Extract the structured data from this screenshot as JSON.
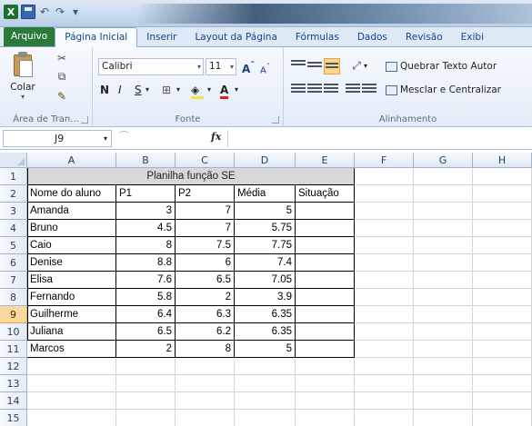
{
  "qat": {
    "app_letter": "X"
  },
  "tabs": [
    "Arquivo",
    "Página Inicial",
    "Inserir",
    "Layout da Página",
    "Fórmulas",
    "Dados",
    "Revisão",
    "Exibi"
  ],
  "ribbon": {
    "clipboard": {
      "paste_label": "Colar",
      "group_label": "Área de Tran..."
    },
    "font": {
      "font_name": "Calibri",
      "font_size": "11",
      "bold": "N",
      "italic": "I",
      "underline": "S",
      "group_label": "Fonte"
    },
    "alignment": {
      "wrap_label": "Quebrar Texto Autor",
      "merge_label": "Mesclar e Centralizar",
      "group_label": "Alinhamento"
    }
  },
  "formula_bar": {
    "name_box": "J9",
    "fx": "fx",
    "value": ""
  },
  "columns": [
    "A",
    "B",
    "C",
    "D",
    "E",
    "F",
    "G",
    "H"
  ],
  "rows": [
    "1",
    "2",
    "3",
    "4",
    "5",
    "6",
    "7",
    "8",
    "9",
    "10",
    "11",
    "12",
    "13",
    "14",
    "15"
  ],
  "selected_row": "9",
  "sheet": {
    "title": "Planilha função SE",
    "headers": [
      "Nome do aluno",
      "P1",
      "P2",
      "Média",
      "Situação"
    ],
    "data": [
      [
        "Amanda",
        "3",
        "7",
        "5",
        ""
      ],
      [
        "Bruno",
        "4.5",
        "7",
        "5.75",
        ""
      ],
      [
        "Caio",
        "8",
        "7.5",
        "7.75",
        ""
      ],
      [
        "Denise",
        "8.8",
        "6",
        "7.4",
        ""
      ],
      [
        "Elisa",
        "7.6",
        "6.5",
        "7.05",
        ""
      ],
      [
        "Fernando",
        "5.8",
        "2",
        "3.9",
        ""
      ],
      [
        "Guilherme",
        "6.4",
        "6.3",
        "6.35",
        ""
      ],
      [
        "Juliana",
        "6.5",
        "6.2",
        "6.35",
        ""
      ],
      [
        "Marcos",
        "2",
        "8",
        "5",
        ""
      ]
    ]
  }
}
